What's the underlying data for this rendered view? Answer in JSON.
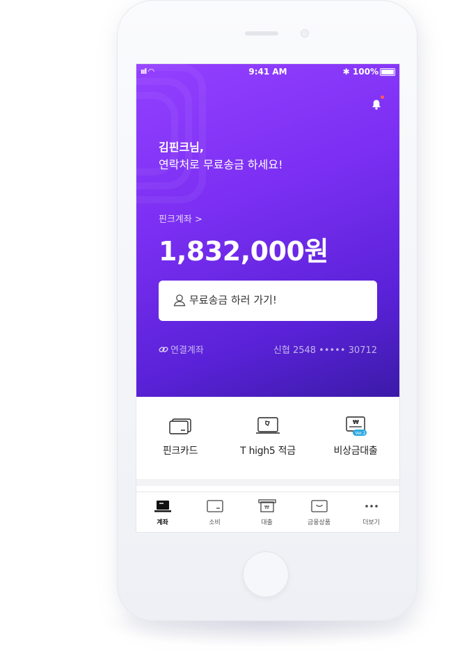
{
  "status_bar": {
    "signal": "ııl",
    "time": "9:41 AM",
    "bluetooth": "✱",
    "battery": "100%"
  },
  "header": {
    "notification_icon": "bell-icon",
    "notification_badge_color": "#ff5a5a"
  },
  "greeting": {
    "name": "김핀크님,",
    "message": "연락처로 무료송금 하세요!"
  },
  "account": {
    "label": "핀크계좌 >",
    "balance": "1,832,000원"
  },
  "send_button": {
    "label": "무료송금 하러 가기!",
    "icon": "person-icon"
  },
  "linked_account": {
    "label": "연결계좌",
    "bank": "신협 2548 ••••• 30712"
  },
  "shortcuts": [
    {
      "label": "핀크카드",
      "icon": "card-icon"
    },
    {
      "label": "T high5 적금",
      "icon": "savings-icon"
    },
    {
      "label": "비상금대출",
      "icon": "emergency-loan-icon",
      "badge": "Ver.2"
    }
  ],
  "tabs": [
    {
      "label": "계좌",
      "icon": "account-icon",
      "active": true
    },
    {
      "label": "소비",
      "icon": "spending-icon",
      "active": false
    },
    {
      "label": "대출",
      "icon": "loan-icon",
      "active": false
    },
    {
      "label": "금융상품",
      "icon": "products-icon",
      "active": false
    },
    {
      "label": "더보기",
      "icon": "more-icon",
      "active": false
    }
  ],
  "colors": {
    "accent_start": "#9440ff",
    "accent_end": "#3b1aa8",
    "badge": "#2aa8e0"
  }
}
